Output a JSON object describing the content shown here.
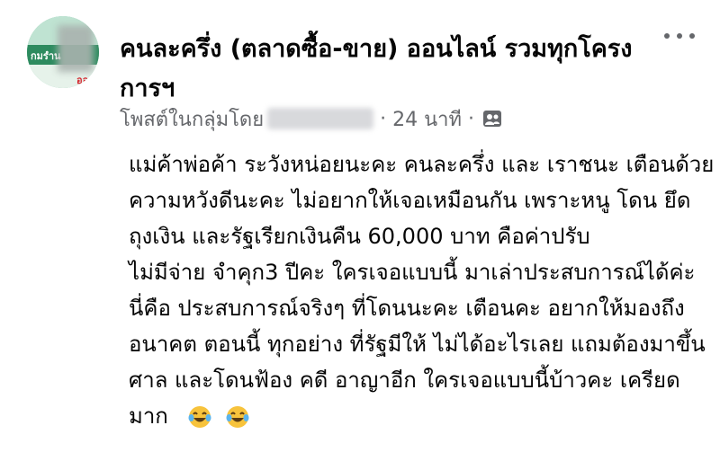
{
  "post": {
    "group_name": "คนละครึ่ง (ตลาดซื้อ-ขาย) ออนไลน์ รวมทุกโครงการฯ",
    "meta_prefix": "โพสต์ในกลุ่มโดย",
    "time": "24 นาที",
    "dot": "·",
    "audience_icon": "group-icon",
    "more_icon": "more-options-icon",
    "avatar_text": "กมรำน",
    "avatar_text_2": "ออ"
  },
  "body": {
    "lines": [
      "แม่ค้าพ่อค้า ระวังหน่อยนะคะ คนละครึ่ง และ เราชนะ เตือนด้วย",
      "ความหวังดีนะคะ ไม่อยากให้เจอเหมือนกัน เพราะหนู โดน ยึด",
      "ถุงเงิน และรัฐเรียกเงินคืน 60,000 บาท คือค่าปรับ",
      "ไม่มีจ่าย จำคุก3 ปีคะ ใครเจอแบบนี้ มาเล่าประสบการณ์ได้ค่ะ",
      "นี่คือ ประสบการณ์จริงๆ ที่โดนนะคะ เตือนคะ อยากให้มองถึง",
      "อนาคต ตอนนี้ ทุกอย่าง ที่รัฐมีให้ ไม่ได้อะไรเลย แถมต้องมาขึ้น",
      "ศาล และโดนฟ้อง คดี อาญาอีก ใครเจอแบบนี้บ้าวคะ เครียด",
      "มาก"
    ],
    "emoji": "laughing-tears-emoji"
  },
  "colors": {
    "text": "#050505",
    "secondary": "#65676b",
    "emoji_face": "#f7c33c"
  }
}
